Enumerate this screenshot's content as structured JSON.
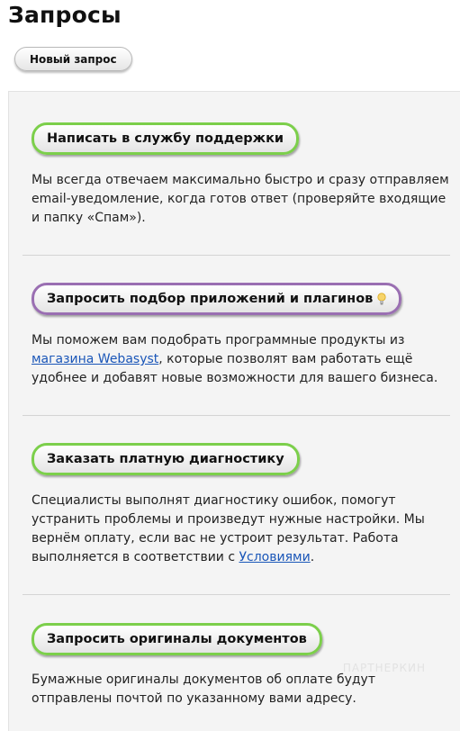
{
  "page": {
    "title": "Запросы",
    "new_request_label": "Новый запрос"
  },
  "sections": [
    {
      "button": "Написать в службу поддержки",
      "description": "Мы всегда отвечаем максимально быстро и сразу отправляем email-уведомление, когда готов ответ (проверяйте входящие и папку «Спам»)."
    },
    {
      "button": "Запросить подбор приложений и плагинов",
      "icon": "lightbulb-icon",
      "desc_before": "Мы поможем вам подобрать программные продукты из ",
      "desc_link": "магазина Webasyst",
      "desc_after": ", которые позволят вам работать ещё удобнее и добавят новые возможности для вашего бизнеса."
    },
    {
      "button": "Заказать платную диагностику",
      "desc_before": "Специалисты выполнят диагностику ошибок, помогут устранить проблемы и произведут нужные настройки. Мы вернём оплату, если вас не устроит результат. Работа выполняется в соответствии с ",
      "desc_link": "Условиями",
      "desc_after": "."
    },
    {
      "button": "Запросить оригиналы документов",
      "description": "Бумажные оригиналы документов об оплате будут отправлены почтой по указанному вами адресу."
    }
  ],
  "watermark": "ПАРТНЕРКИН",
  "colors": {
    "green_border": "#7ccf4b",
    "purple_border": "#9a6fb2",
    "link": "#1a56b8",
    "panel_bg": "#f4f4f4"
  }
}
